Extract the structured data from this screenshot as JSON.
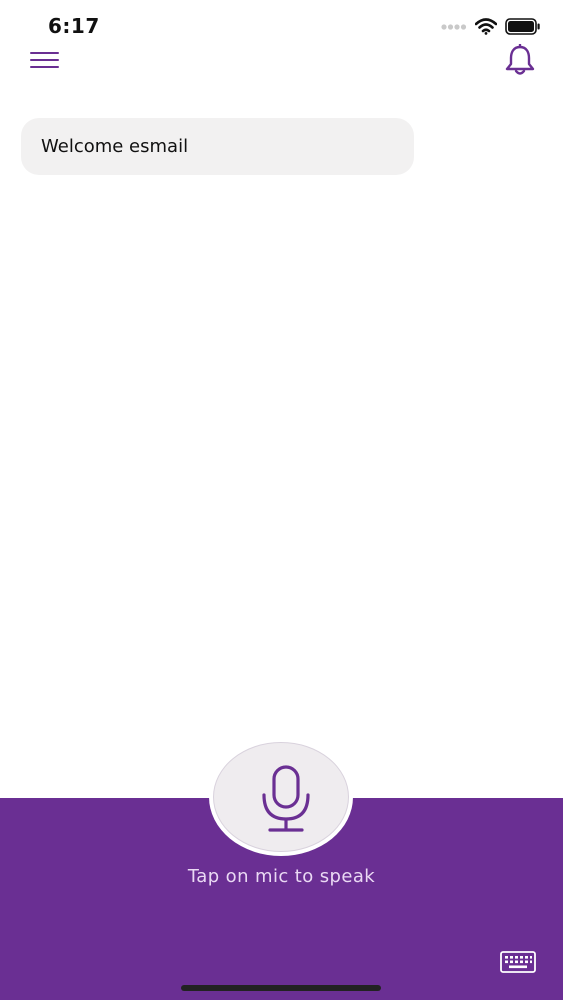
{
  "status_bar": {
    "time": "6:17",
    "icons": [
      "signal-dots-icon",
      "wifi-icon",
      "battery-icon"
    ]
  },
  "header": {
    "menu_icon": "hamburger-menu-icon",
    "notification_icon": "bell-icon"
  },
  "chat": {
    "messages": [
      {
        "text": "Welcome esmail"
      }
    ]
  },
  "voice_panel": {
    "mic_icon": "microphone-icon",
    "hint": "Tap on mic to speak",
    "keyboard_icon": "keyboard-icon"
  },
  "colors": {
    "accent": "#6a2f93",
    "bubble": "#f2f1f1",
    "hint_text": "#ead9f4"
  }
}
